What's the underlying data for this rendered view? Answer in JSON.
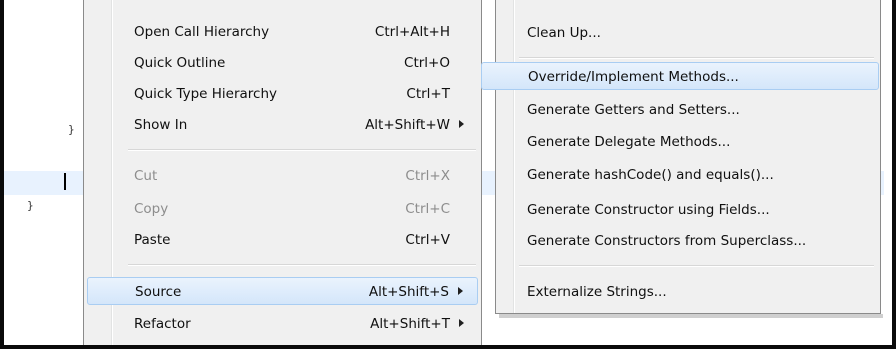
{
  "editor": {
    "inner_brace": "}",
    "outer_brace": "}"
  },
  "context_menu": {
    "items": [
      {
        "label": "Open Call Hierarchy",
        "shortcut": "Ctrl+Alt+H"
      },
      {
        "label": "Quick Outline",
        "shortcut": "Ctrl+O"
      },
      {
        "label": "Quick Type Hierarchy",
        "shortcut": "Ctrl+T"
      },
      {
        "label": "Show In",
        "shortcut": "Alt+Shift+W",
        "submenu": true
      },
      {
        "label": "Cut",
        "shortcut": "Ctrl+X",
        "disabled": true
      },
      {
        "label": "Copy",
        "shortcut": "Ctrl+C",
        "disabled": true
      },
      {
        "label": "Paste",
        "shortcut": "Ctrl+V"
      },
      {
        "label": "Source",
        "shortcut": "Alt+Shift+S",
        "submenu": true,
        "selected": true
      },
      {
        "label": "Refactor",
        "shortcut": "Alt+Shift+T",
        "submenu": true
      }
    ]
  },
  "source_submenu": {
    "items": [
      {
        "label": "Clean Up..."
      },
      {
        "label": "Override/Implement Methods...",
        "selected": true
      },
      {
        "label": "Generate Getters and Setters..."
      },
      {
        "label": "Generate Delegate Methods..."
      },
      {
        "label": "Generate hashCode() and equals()..."
      },
      {
        "label": "Generate Constructor using Fields..."
      },
      {
        "label": "Generate Constructors from Superclass..."
      },
      {
        "label": "Externalize Strings..."
      }
    ]
  },
  "colors": {
    "menu_bg": "#f0f0f0",
    "selection_bg": "#d4e6fa",
    "selection_border": "#a9cdf2",
    "editor_current_line": "#e8f2fe",
    "disabled_text": "#8d8d8d"
  }
}
